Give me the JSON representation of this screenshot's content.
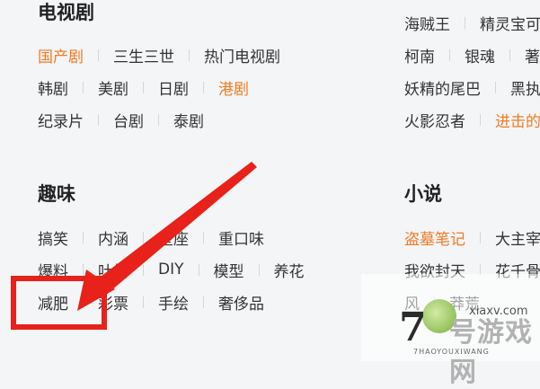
{
  "tv": {
    "title": "电视剧",
    "rows": [
      [
        {
          "t": "国产剧",
          "hl": true
        },
        {
          "t": "三生三世"
        },
        {
          "t": "热门电视剧"
        }
      ],
      [
        {
          "t": "韩剧"
        },
        {
          "t": "美剧"
        },
        {
          "t": "日剧"
        },
        {
          "t": "港剧",
          "hl": true
        }
      ],
      [
        {
          "t": "纪录片"
        },
        {
          "t": "台剧"
        },
        {
          "t": "泰剧"
        }
      ]
    ]
  },
  "anime": {
    "rows": [
      [
        {
          "t": "海贼王"
        },
        {
          "t": "精灵宝可"
        }
      ],
      [
        {
          "t": "柯南"
        },
        {
          "t": "银魂"
        },
        {
          "t": "著"
        }
      ],
      [
        {
          "t": "妖精的尾巴"
        },
        {
          "t": "黑执"
        }
      ],
      [
        {
          "t": "火影忍者"
        },
        {
          "t": "进击的",
          "hl": true
        }
      ]
    ]
  },
  "fun": {
    "title": "趣味",
    "rows": [
      [
        {
          "t": "搞笑"
        },
        {
          "t": "内涵"
        },
        {
          "t": "星座"
        },
        {
          "t": "重口味"
        }
      ],
      [
        {
          "t": "爆料"
        },
        {
          "t": "吐槽"
        },
        {
          "t": "DIY"
        },
        {
          "t": "模型"
        },
        {
          "t": "养花"
        }
      ],
      [
        {
          "t": "减肥"
        },
        {
          "t": "彩票"
        },
        {
          "t": "手绘"
        },
        {
          "t": "奢侈品"
        }
      ]
    ]
  },
  "novel": {
    "title": "小说",
    "rows": [
      [
        {
          "t": "盗墓笔记",
          "hl": true
        },
        {
          "t": "大主宰"
        }
      ],
      [
        {
          "t": "我欲封天"
        },
        {
          "t": "花千骨"
        }
      ],
      [
        {
          "t": "风"
        },
        {
          "t": "莽荒"
        }
      ]
    ]
  },
  "watermark": {
    "seven": "7",
    "brand_cn": "号游戏网",
    "site": "xiaxv.com",
    "sub": "7HAOYOUXIWANG"
  },
  "colors": {
    "accent": "#f07b22",
    "arrow": "#e8211a"
  }
}
